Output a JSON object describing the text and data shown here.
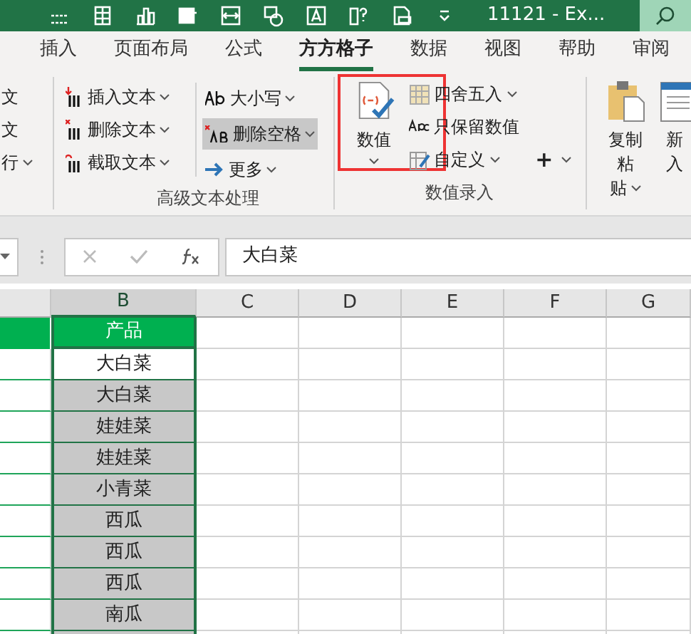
{
  "title_bar": {
    "title": "11121  -  Ex..."
  },
  "tabs": [
    {
      "label": "插入",
      "selected": false
    },
    {
      "label": "页面布局",
      "selected": false
    },
    {
      "label": "公式",
      "selected": false
    },
    {
      "label": "方方格子",
      "selected": true
    },
    {
      "label": "数据",
      "selected": false
    },
    {
      "label": "视图",
      "selected": false
    },
    {
      "label": "帮助",
      "selected": false
    },
    {
      "label": "审阅",
      "selected": false
    }
  ],
  "ribbon": {
    "partial_group": {
      "items": [
        "文",
        "文",
        "行"
      ]
    },
    "text_group": {
      "label": "高级文本处理",
      "left_items": [
        "插入文本",
        "删除文本",
        "截取文本"
      ],
      "right_items": [
        {
          "label": "大小写",
          "selected": false
        },
        {
          "label": "删除空格",
          "selected": true
        },
        {
          "label": "更多",
          "selected": false
        }
      ]
    },
    "number_group": {
      "label": "数值录入",
      "big_button": "数值",
      "items": [
        "四舍五入",
        "只保留数值",
        "自定义"
      ],
      "plus": "+"
    },
    "paste_group": {
      "copy_paste": [
        "复制粘",
        "贴"
      ],
      "new_partial": [
        "新",
        "入"
      ]
    }
  },
  "formula_bar": {
    "value": "大白菜"
  },
  "columns": [
    {
      "selected": false
    },
    {
      "letter": "B",
      "selected": true
    },
    {
      "letter": "C",
      "selected": false
    },
    {
      "letter": "D",
      "selected": false
    },
    {
      "letter": "E",
      "selected": false
    },
    {
      "letter": "F",
      "selected": false
    },
    {
      "letter": "G",
      "selected": false
    }
  ],
  "rows": [
    {
      "kind": "header",
      "b": "产品"
    },
    {
      "kind": "active",
      "b": "大白菜"
    },
    {
      "kind": "selected",
      "b": "大白菜"
    },
    {
      "kind": "selected",
      "b": "娃娃菜"
    },
    {
      "kind": "selected",
      "b": "娃娃菜"
    },
    {
      "kind": "selected",
      "b": "小青菜"
    },
    {
      "kind": "selected",
      "b": "西瓜"
    },
    {
      "kind": "selected",
      "b": "西瓜"
    },
    {
      "kind": "selected",
      "b": "西瓜"
    },
    {
      "kind": "selected",
      "b": "南瓜"
    },
    {
      "kind": "selected"
    }
  ]
}
